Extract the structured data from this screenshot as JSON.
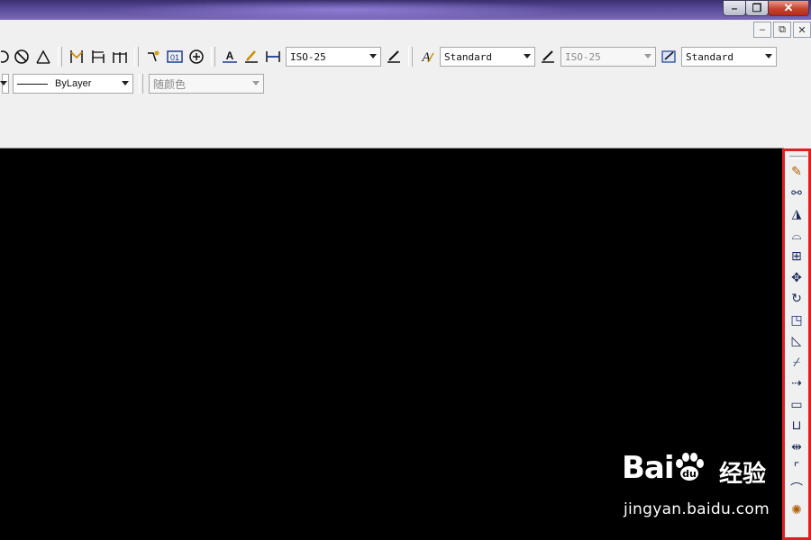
{
  "window": {
    "minimize_glyph": "–",
    "restore_glyph": "❐",
    "close_glyph": "✕"
  },
  "mdi": {
    "minimize_glyph": "–",
    "restore_glyph": "⧉",
    "close_glyph": "✕"
  },
  "toolbar1": {
    "dim_style": "ISO-25",
    "text_style": "Standard",
    "multileader_style": "ISO-25",
    "table_style": "Standard"
  },
  "toolbar2": {
    "linetype": "ByLayer",
    "color": "随颜色"
  },
  "modify_toolbar": {
    "items": [
      {
        "name": "erase",
        "glyph": "✎"
      },
      {
        "name": "copy",
        "glyph": "⚯"
      },
      {
        "name": "mirror",
        "glyph": "◮"
      },
      {
        "name": "offset",
        "glyph": "⌓"
      },
      {
        "name": "array",
        "glyph": "⊞"
      },
      {
        "name": "move",
        "glyph": "✥"
      },
      {
        "name": "rotate",
        "glyph": "↻"
      },
      {
        "name": "scale",
        "glyph": "◳"
      },
      {
        "name": "stretch",
        "glyph": "◺"
      },
      {
        "name": "trim",
        "glyph": "⌿"
      },
      {
        "name": "extend",
        "glyph": "⇢"
      },
      {
        "name": "break-at-point",
        "glyph": "▭"
      },
      {
        "name": "break",
        "glyph": "⊔"
      },
      {
        "name": "join",
        "glyph": "⇹"
      },
      {
        "name": "chamfer",
        "glyph": "⌜"
      },
      {
        "name": "fillet",
        "glyph": "⌒"
      },
      {
        "name": "explode",
        "glyph": "✺"
      }
    ]
  },
  "watermark": {
    "logo": "Bai",
    "logo_suffix": "du",
    "chinese": "经验",
    "url": "jingyan.baidu.com"
  },
  "colors": {
    "highlight_border": "#e02020",
    "drawing_background": "#000000",
    "toolbar_background": "#f0f0f0"
  }
}
